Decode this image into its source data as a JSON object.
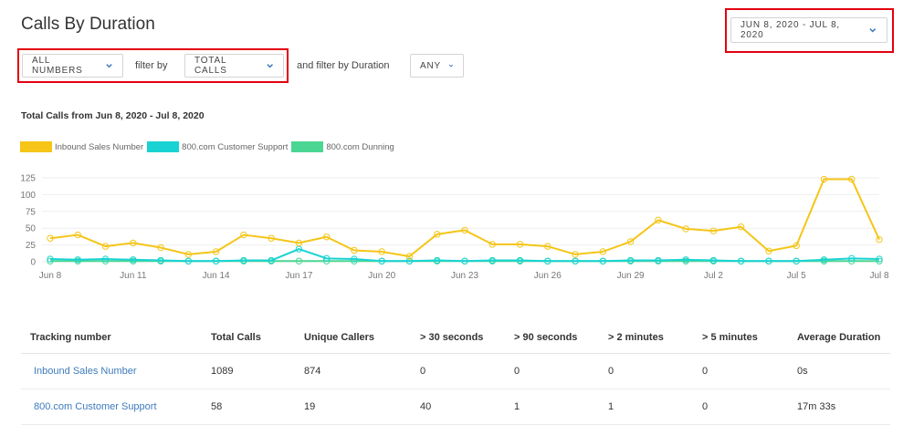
{
  "page": {
    "title": "Calls By Duration"
  },
  "date_range": {
    "label": "JUN 8, 2020 - JUL 8, 2020"
  },
  "filters": {
    "numbers_label": "ALL NUMBERS",
    "filter_by_text": "filter by",
    "metric_label": "TOTAL CALLS",
    "duration_text": "and filter by Duration",
    "duration_label": "ANY"
  },
  "colors": {
    "highlight": "#e3000f",
    "series_inbound": "#f5c518",
    "series_support": "#19d3d3",
    "series_dunning": "#4cd693",
    "link": "#3e7bbd"
  },
  "chart_data": {
    "type": "line",
    "title": "Total Calls from Jun 8, 2020 - Jul 8, 2020",
    "x_ticks": [
      "Jun 8",
      "Jun 11",
      "Jun 14",
      "Jun 17",
      "Jun 20",
      "Jun 23",
      "Jun 26",
      "Jun 29",
      "Jul 2",
      "Jul 5",
      "Jul 8"
    ],
    "y_ticks": [
      "0",
      "25",
      "50",
      "75",
      "100",
      "125"
    ],
    "ylim": [
      0,
      125
    ],
    "grid": true,
    "legend_position": "top-left",
    "series": [
      {
        "name": "Inbound Sales Number",
        "color": "#f5c518",
        "values": [
          35,
          40,
          23,
          28,
          21,
          11,
          15,
          40,
          35,
          28,
          37,
          17,
          15,
          8,
          41,
          47,
          26,
          26,
          23,
          11,
          15,
          30,
          62,
          49,
          46,
          52,
          16,
          24,
          123,
          123,
          33
        ]
      },
      {
        "name": "800.com Customer Support",
        "color": "#19d3d3",
        "values": [
          4,
          3,
          4,
          3,
          2,
          1,
          1,
          2,
          2,
          19,
          5,
          4,
          1,
          1,
          2,
          1,
          2,
          2,
          1,
          1,
          1,
          2,
          2,
          3,
          2,
          1,
          1,
          1,
          3,
          5,
          4
        ]
      },
      {
        "name": "800.com Dunning",
        "color": "#4cd693",
        "values": [
          1,
          1,
          1,
          1,
          1,
          1,
          1,
          1,
          1,
          1,
          1,
          1,
          1,
          1,
          1,
          1,
          1,
          1,
          1,
          1,
          1,
          1,
          1,
          1,
          1,
          1,
          1,
          1,
          1,
          1,
          1
        ]
      }
    ]
  },
  "table": {
    "headers": [
      "Tracking number",
      "Total Calls",
      "Unique Callers",
      "> 30 seconds",
      "> 90 seconds",
      "> 2 minutes",
      "> 5 minutes",
      "Average Duration"
    ],
    "rows": [
      [
        "Inbound Sales Number",
        "1089",
        "874",
        "0",
        "0",
        "0",
        "0",
        "0s"
      ],
      [
        "800.com Customer Support",
        "58",
        "19",
        "40",
        "1",
        "1",
        "0",
        "17m 33s"
      ]
    ]
  }
}
